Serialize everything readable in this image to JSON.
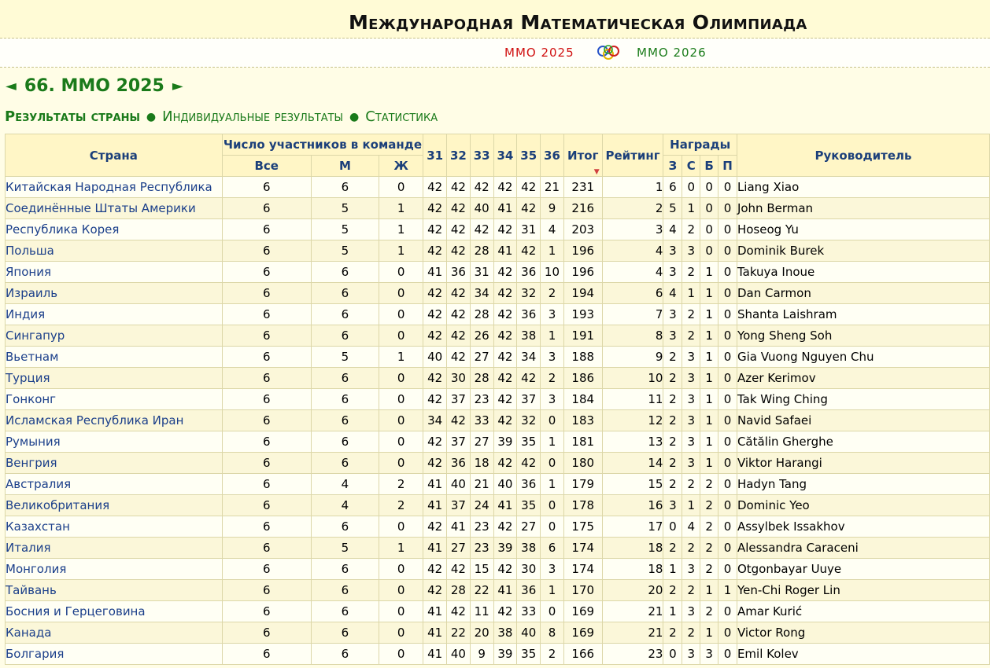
{
  "site_title": "Международная Математическая Олимпиада",
  "nav": {
    "prev_label": "ММО 2025",
    "next_label": "ММО 2026"
  },
  "heading": {
    "prev_arrow": "◄",
    "title": "66. ММО 2025",
    "next_arrow": "►"
  },
  "tabs": [
    {
      "label": "Результаты страны",
      "active": true
    },
    {
      "label": "Индивидуальные результаты",
      "active": false
    },
    {
      "label": "Статистика",
      "active": false
    }
  ],
  "table": {
    "headers": {
      "country": "Страна",
      "team_size": "Число участников в команде",
      "all": "Все",
      "male": "М",
      "female": "Ж",
      "problems": [
        "31",
        "32",
        "33",
        "34",
        "35",
        "36"
      ],
      "total": "Итог",
      "rank": "Рейтинг",
      "awards": "Награды",
      "award_cols": [
        "З",
        "С",
        "Б",
        "П"
      ],
      "leader": "Руководитель"
    },
    "rows": [
      [
        "Китайская Народная Республика",
        "6",
        "6",
        "0",
        "42",
        "42",
        "42",
        "42",
        "42",
        "21",
        "231",
        "1",
        "6",
        "0",
        "0",
        "0",
        "Liang Xiao"
      ],
      [
        "Соединённые Штаты Америки",
        "6",
        "5",
        "1",
        "42",
        "42",
        "40",
        "41",
        "42",
        "9",
        "216",
        "2",
        "5",
        "1",
        "0",
        "0",
        "John Berman"
      ],
      [
        "Республика Корея",
        "6",
        "5",
        "1",
        "42",
        "42",
        "42",
        "42",
        "31",
        "4",
        "203",
        "3",
        "4",
        "2",
        "0",
        "0",
        "Hoseog Yu"
      ],
      [
        "Польша",
        "6",
        "5",
        "1",
        "42",
        "42",
        "28",
        "41",
        "42",
        "1",
        "196",
        "4",
        "3",
        "3",
        "0",
        "0",
        "Dominik Burek"
      ],
      [
        "Япония",
        "6",
        "6",
        "0",
        "41",
        "36",
        "31",
        "42",
        "36",
        "10",
        "196",
        "4",
        "3",
        "2",
        "1",
        "0",
        "Takuya Inoue"
      ],
      [
        "Израиль",
        "6",
        "6",
        "0",
        "42",
        "42",
        "34",
        "42",
        "32",
        "2",
        "194",
        "6",
        "4",
        "1",
        "1",
        "0",
        "Dan Carmon"
      ],
      [
        "Индия",
        "6",
        "6",
        "0",
        "42",
        "42",
        "28",
        "42",
        "36",
        "3",
        "193",
        "7",
        "3",
        "2",
        "1",
        "0",
        "Shanta Laishram"
      ],
      [
        "Сингапур",
        "6",
        "6",
        "0",
        "42",
        "42",
        "26",
        "42",
        "38",
        "1",
        "191",
        "8",
        "3",
        "2",
        "1",
        "0",
        "Yong Sheng Soh"
      ],
      [
        "Вьетнам",
        "6",
        "5",
        "1",
        "40",
        "42",
        "27",
        "42",
        "34",
        "3",
        "188",
        "9",
        "2",
        "3",
        "1",
        "0",
        "Gia Vuong Nguyen Chu"
      ],
      [
        "Турция",
        "6",
        "6",
        "0",
        "42",
        "30",
        "28",
        "42",
        "42",
        "2",
        "186",
        "10",
        "2",
        "3",
        "1",
        "0",
        "Azer Kerimov"
      ],
      [
        "Гонконг",
        "6",
        "6",
        "0",
        "42",
        "37",
        "23",
        "42",
        "37",
        "3",
        "184",
        "11",
        "2",
        "3",
        "1",
        "0",
        "Tak Wing Ching"
      ],
      [
        "Исламская Республика Иран",
        "6",
        "6",
        "0",
        "34",
        "42",
        "33",
        "42",
        "32",
        "0",
        "183",
        "12",
        "2",
        "3",
        "1",
        "0",
        "Navid Safaei"
      ],
      [
        "Румыния",
        "6",
        "6",
        "0",
        "42",
        "37",
        "27",
        "39",
        "35",
        "1",
        "181",
        "13",
        "2",
        "3",
        "1",
        "0",
        "Cătălin Gherghe"
      ],
      [
        "Венгрия",
        "6",
        "6",
        "0",
        "42",
        "36",
        "18",
        "42",
        "42",
        "0",
        "180",
        "14",
        "2",
        "3",
        "1",
        "0",
        "Viktor Harangi"
      ],
      [
        "Австралия",
        "6",
        "4",
        "2",
        "41",
        "40",
        "21",
        "40",
        "36",
        "1",
        "179",
        "15",
        "2",
        "2",
        "2",
        "0",
        "Hadyn Tang"
      ],
      [
        "Великобритания",
        "6",
        "4",
        "2",
        "41",
        "37",
        "24",
        "41",
        "35",
        "0",
        "178",
        "16",
        "3",
        "1",
        "2",
        "0",
        "Dominic Yeo"
      ],
      [
        "Казахстан",
        "6",
        "6",
        "0",
        "42",
        "41",
        "23",
        "42",
        "27",
        "0",
        "175",
        "17",
        "0",
        "4",
        "2",
        "0",
        "Assylbek Issakhov"
      ],
      [
        "Италия",
        "6",
        "5",
        "1",
        "41",
        "27",
        "23",
        "39",
        "38",
        "6",
        "174",
        "18",
        "2",
        "2",
        "2",
        "0",
        "Alessandra Caraceni"
      ],
      [
        "Монголия",
        "6",
        "6",
        "0",
        "42",
        "42",
        "15",
        "42",
        "30",
        "3",
        "174",
        "18",
        "1",
        "3",
        "2",
        "0",
        "Otgonbayar Uuye"
      ],
      [
        "Тайвань",
        "6",
        "6",
        "0",
        "42",
        "28",
        "22",
        "41",
        "36",
        "1",
        "170",
        "20",
        "2",
        "2",
        "1",
        "1",
        "Yen-Chi Roger Lin"
      ],
      [
        "Босния и Герцеговина",
        "6",
        "6",
        "0",
        "41",
        "42",
        "11",
        "42",
        "33",
        "0",
        "169",
        "21",
        "1",
        "3",
        "2",
        "0",
        "Amar Kurić"
      ],
      [
        "Канада",
        "6",
        "6",
        "0",
        "41",
        "22",
        "20",
        "38",
        "40",
        "8",
        "169",
        "21",
        "2",
        "2",
        "1",
        "0",
        "Victor Rong"
      ],
      [
        "Болгария",
        "6",
        "6",
        "0",
        "41",
        "40",
        "9",
        "39",
        "35",
        "2",
        "166",
        "23",
        "0",
        "3",
        "3",
        "0",
        "Emil Kolev"
      ]
    ]
  },
  "colors": {
    "accent_green": "#1a7a1a",
    "link_blue": "#1b3f8a",
    "prev_red": "#d01010"
  },
  "icons": {
    "logo": "imo-rings-logo",
    "sort": "sort-desc-icon"
  }
}
